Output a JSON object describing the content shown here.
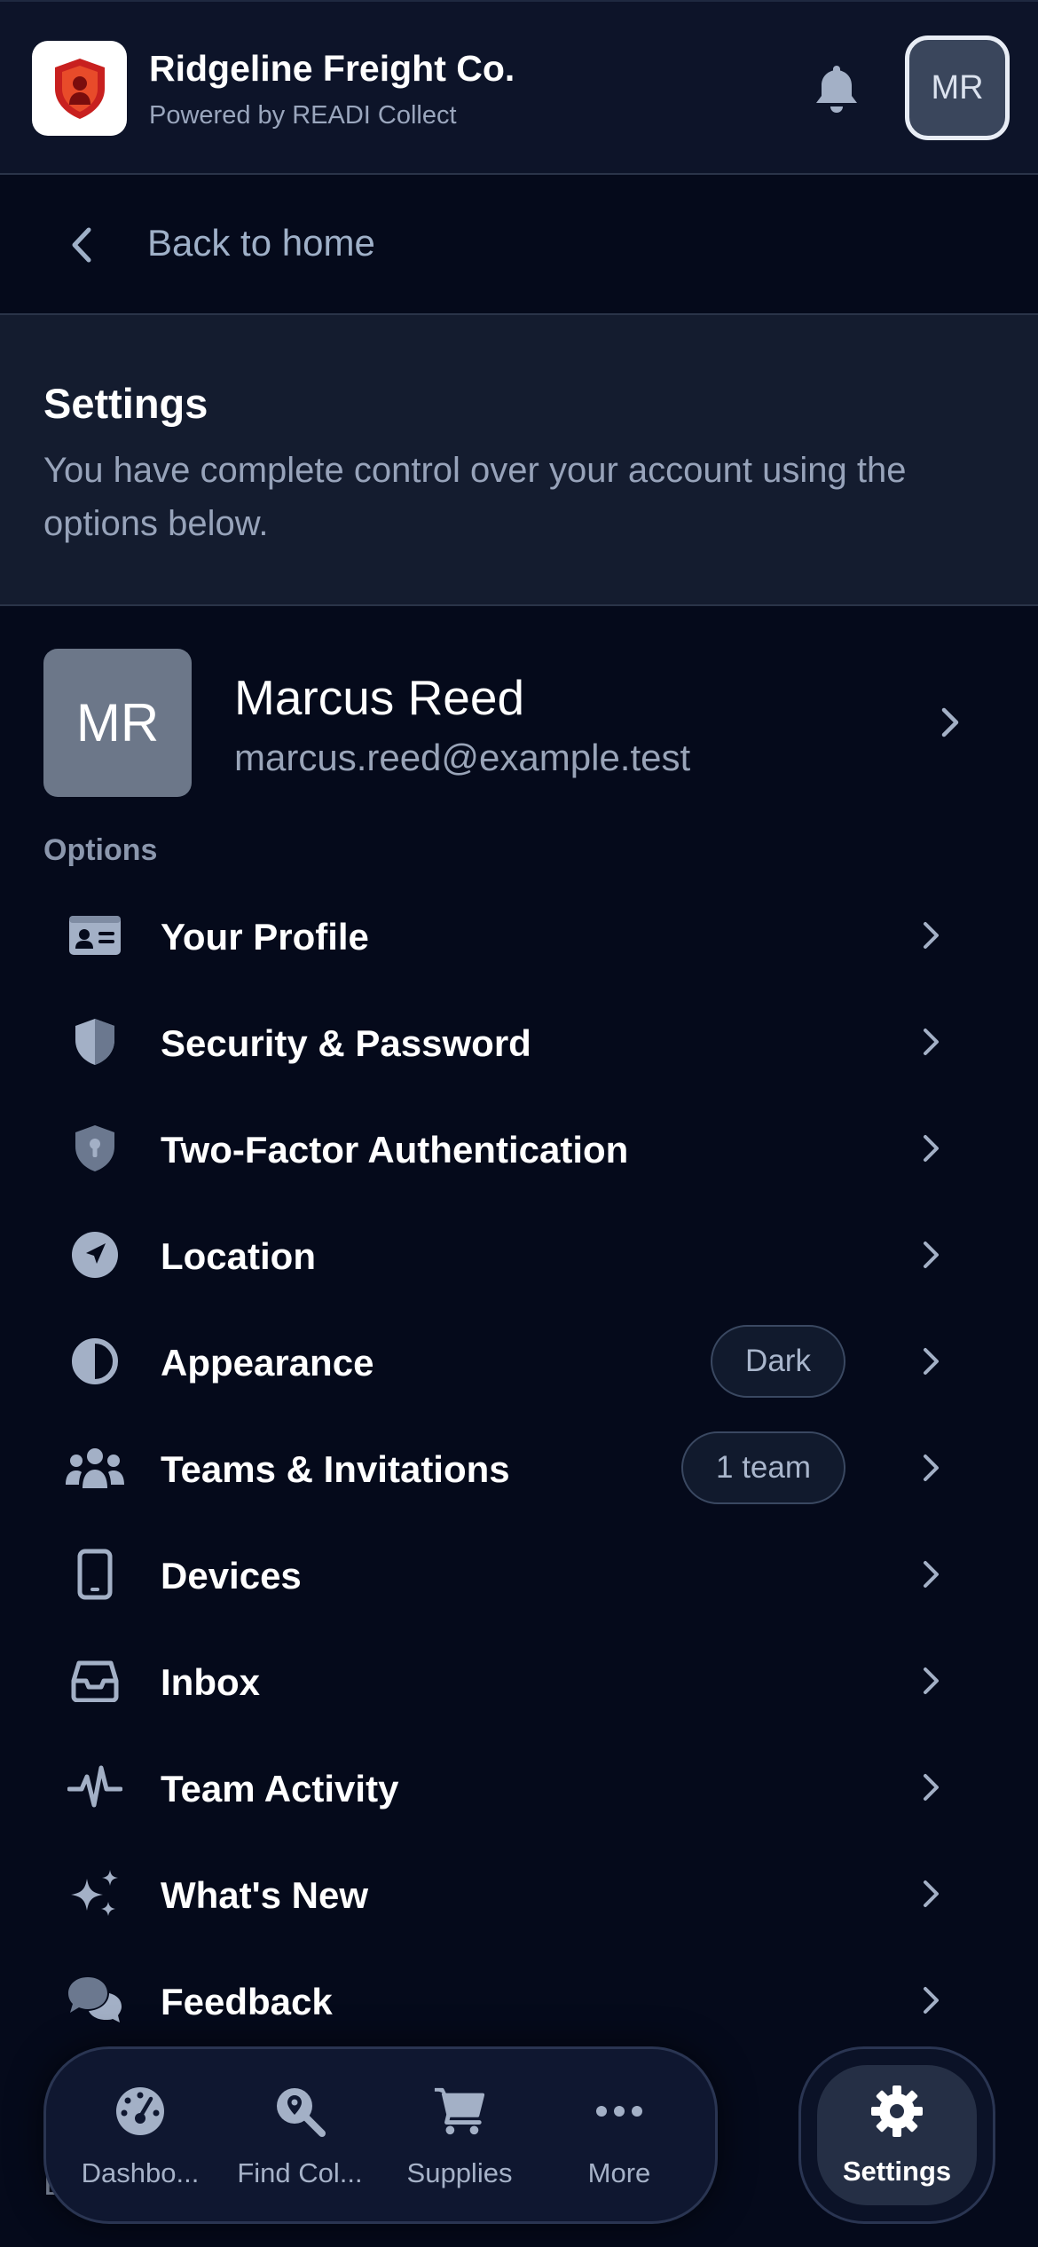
{
  "header": {
    "org_name": "Ridgeline Freight Co.",
    "powered_by": "Powered by READI Collect",
    "avatar_initials": "MR"
  },
  "back": {
    "label": "Back to home"
  },
  "settings_intro": {
    "title": "Settings",
    "description": "You have complete control over your account using the options below."
  },
  "profile": {
    "initials": "MR",
    "name": "Marcus Reed",
    "email": "marcus.reed@example.test"
  },
  "options_heading": "Options",
  "menu": [
    {
      "label": "Your Profile",
      "icon": "id-card-icon"
    },
    {
      "label": "Security & Password",
      "icon": "shield-half-icon"
    },
    {
      "label": "Two-Factor Authentication",
      "icon": "shield-keyhole-icon"
    },
    {
      "label": "Location",
      "icon": "location-arrow-icon"
    },
    {
      "label": "Appearance",
      "icon": "contrast-icon",
      "badge": "Dark"
    },
    {
      "label": "Teams & Invitations",
      "icon": "users-icon",
      "badge": "1 team"
    },
    {
      "label": "Devices",
      "icon": "mobile-icon"
    },
    {
      "label": "Inbox",
      "icon": "inbox-tray-icon"
    },
    {
      "label": "Team Activity",
      "icon": "pulse-icon"
    },
    {
      "label": "What's New",
      "icon": "sparkles-icon"
    },
    {
      "label": "Feedback",
      "icon": "comments-icon"
    }
  ],
  "partial_text": "L",
  "bottom_nav": {
    "items": [
      {
        "label": "Dashbo...",
        "icon": "gauge-icon"
      },
      {
        "label": "Find Col...",
        "icon": "location-search-icon"
      },
      {
        "label": "Supplies",
        "icon": "cart-icon"
      },
      {
        "label": "More",
        "icon": "ellipsis-icon"
      }
    ],
    "settings_label": "Settings",
    "settings_icon": "gear-icon"
  },
  "colors": {
    "background": "#050a1b",
    "header_bg": "#0d1429",
    "card_bg": "#141c2f",
    "icon": "#a3b0c6",
    "muted_text": "#97a3ba"
  }
}
